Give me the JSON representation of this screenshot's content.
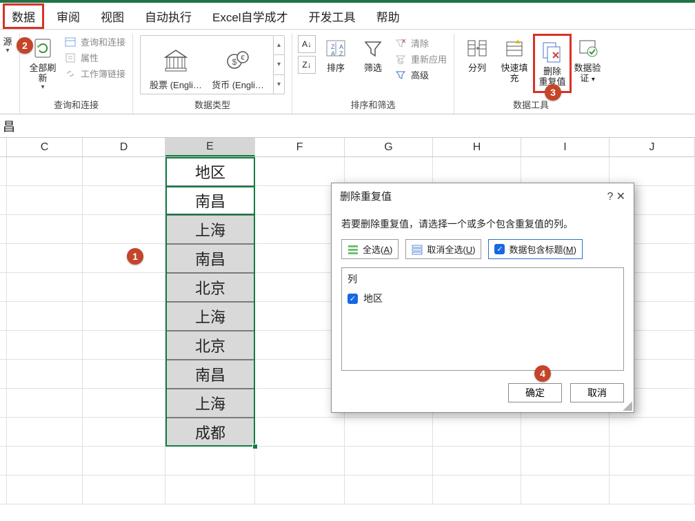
{
  "tabs": [
    "数据",
    "审阅",
    "视图",
    "自动执行",
    "Excel自学成才",
    "开发工具",
    "帮助"
  ],
  "ribbon": {
    "source_label": "源",
    "refresh_all": "全部刷新",
    "queries_connections": "查询和连接",
    "properties": "属性",
    "workbook_links": "工作簿链接",
    "group_queries": "查询和连接",
    "stocks": "股票 (Engli…",
    "currency": "货币 (Engli…",
    "group_types": "数据类型",
    "sort": "排序",
    "filter": "筛选",
    "clear": "清除",
    "reapply": "重新应用",
    "advanced": "高级",
    "group_sortfilter": "排序和筛选",
    "text_to_cols": "分列",
    "flash_fill": "快速填充",
    "remove_dup1": "删除",
    "remove_dup2": "重复值",
    "data_validation1": "数据验",
    "data_validation2": "证",
    "group_tools": "数据工具"
  },
  "namebar_value": "昌",
  "columns": [
    "C",
    "D",
    "E",
    "F",
    "G",
    "H",
    "I",
    "J"
  ],
  "col_e": {
    "header": "地区",
    "data": [
      "南昌",
      "上海",
      "南昌",
      "北京",
      "上海",
      "北京",
      "南昌",
      "上海",
      "成都"
    ]
  },
  "dialog": {
    "title": "删除重复值",
    "help": "?",
    "close": "✕",
    "desc": "若要删除重复值，请选择一个或多个包含重复值的列。",
    "select_all_pre": "全选(",
    "select_all_acc": "A",
    "select_all_post": ")",
    "unselect_all_pre": "取消全选(",
    "unselect_all_acc": "U",
    "unselect_all_post": ")",
    "has_header_pre": "数据包含标题(",
    "has_header_acc": "M",
    "has_header_post": ")",
    "col_label": "列",
    "col_item": "地区",
    "ok": "确定",
    "cancel": "取消"
  },
  "counters": {
    "c1": "1",
    "c2": "2",
    "c3": "3",
    "c4": "4"
  }
}
